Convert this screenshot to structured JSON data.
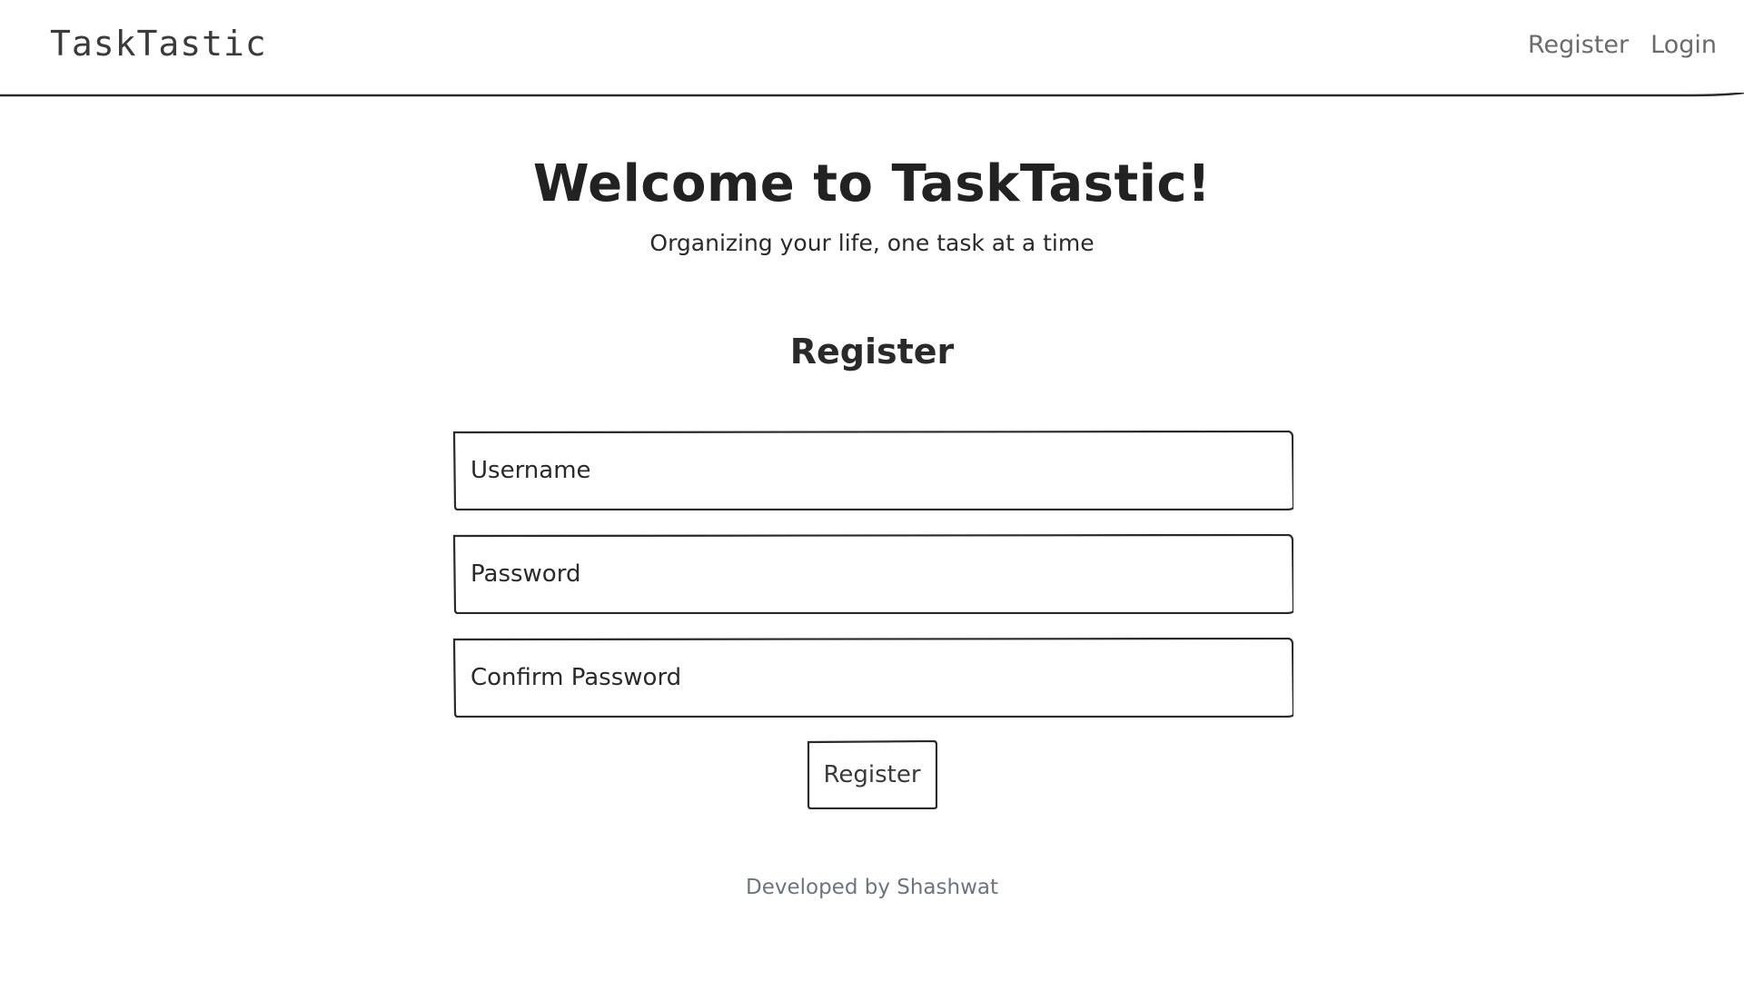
{
  "navbar": {
    "brand": "TaskTastic",
    "links": [
      {
        "label": "Register"
      },
      {
        "label": "Login"
      }
    ]
  },
  "hero": {
    "title": "Welcome to TaskTastic!",
    "subtitle": "Organizing your life, one task at a time"
  },
  "form": {
    "heading": "Register",
    "username_placeholder": "Username",
    "password_placeholder": "Password",
    "confirm_password_placeholder": "Confirm Password",
    "submit_label": "Register"
  },
  "footer": {
    "text": "Developed by Shashwat"
  },
  "colors": {
    "text": "#2a2a2a",
    "muted": "#6c757d",
    "border": "#2a2a2a",
    "background": "#ffffff"
  }
}
